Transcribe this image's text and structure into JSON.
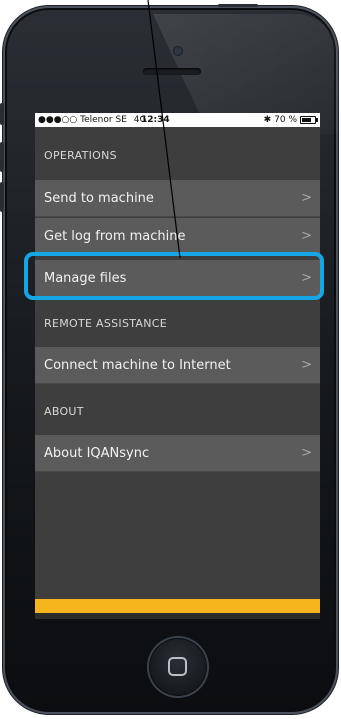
{
  "status_bar": {
    "carrier": "●●●○○ Telenor SE",
    "network": "4G",
    "time": "12:34",
    "bluetooth_icon": "bluetooth-icon",
    "battery_text": "70 %",
    "battery_icon": "battery-icon"
  },
  "sections": {
    "operations": {
      "header": "OPERATIONS",
      "items": [
        {
          "label": "Send to machine",
          "chevron": ">"
        },
        {
          "label": "Get log from machine",
          "chevron": ">"
        },
        {
          "label": "Manage files",
          "chevron": ">"
        }
      ]
    },
    "remote": {
      "header": "REMOTE ASSISTANCE",
      "items": [
        {
          "label": "Connect machine to Internet",
          "chevron": ">"
        }
      ]
    },
    "about": {
      "header": "ABOUT",
      "items": [
        {
          "label": "About IQANsync",
          "chevron": ">"
        }
      ]
    }
  },
  "colors": {
    "accent_bar": "#f6b51c",
    "highlight": "#15a6e6",
    "row_bg": "#5b5b5b",
    "screen_bg": "#3e3e3e"
  },
  "icons": {
    "chevron": "chevron-right-icon",
    "home": "home-button-icon"
  }
}
